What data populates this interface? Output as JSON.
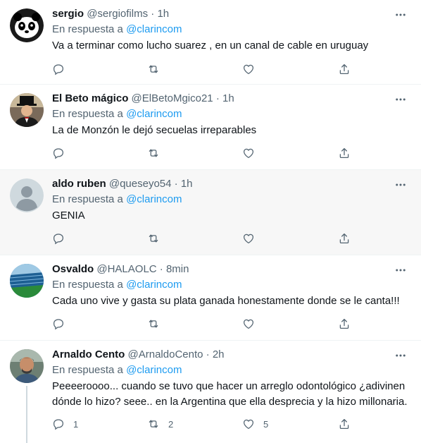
{
  "tweets": [
    {
      "name": "sergio",
      "handle": "@sergiofilms",
      "time": "1h",
      "reply_prefix": "En respuesta a",
      "reply_to": "@clarincom",
      "text": "Va a terminar como lucho suarez , en un canal de cable en uruguay",
      "replies": "",
      "retweets": "",
      "likes": "",
      "avatar": "panda-avatar"
    },
    {
      "name": "El Beto mágico",
      "handle": "@ElBetoMgico21",
      "time": "1h",
      "reply_prefix": "En respuesta a",
      "reply_to": "@clarincom",
      "text": "La de Monzón le dejó secuelas irreparables",
      "replies": "",
      "retweets": "",
      "likes": "",
      "avatar": "tophat-avatar"
    },
    {
      "name": "aldo ruben",
      "handle": "@queseyo54",
      "time": "1h",
      "reply_prefix": "En respuesta a",
      "reply_to": "@clarincom",
      "text": "GENIA",
      "replies": "",
      "retweets": "",
      "likes": "",
      "avatar": "default-avatar"
    },
    {
      "name": "Osvaldo",
      "handle": "@HALAOLC",
      "time": "8min",
      "reply_prefix": "En respuesta a",
      "reply_to": "@clarincom",
      "text": "Cada uno vive y gasta su plata ganada honestamente donde se le canta!!!",
      "replies": "",
      "retweets": "",
      "likes": "",
      "avatar": "stadium-avatar"
    },
    {
      "name": "Arnaldo Cento",
      "handle": "@ArnaldoCento",
      "time": "2h",
      "reply_prefix": "En respuesta a",
      "reply_to": "@clarincom",
      "text": "Peeeeroooo... cuando se tuvo que hacer un arreglo odontológico ¿adivinen dónde lo hizo? seee.. en la Argentina que ella desprecia y la hizo millonaria.",
      "replies": "1",
      "retweets": "2",
      "likes": "5",
      "avatar": "man-avatar"
    }
  ],
  "separator": "·",
  "colors": {
    "link": "#1d9bf0",
    "muted": "#536471",
    "text": "#0f1419",
    "hover_bg": "#f7f7f7"
  }
}
